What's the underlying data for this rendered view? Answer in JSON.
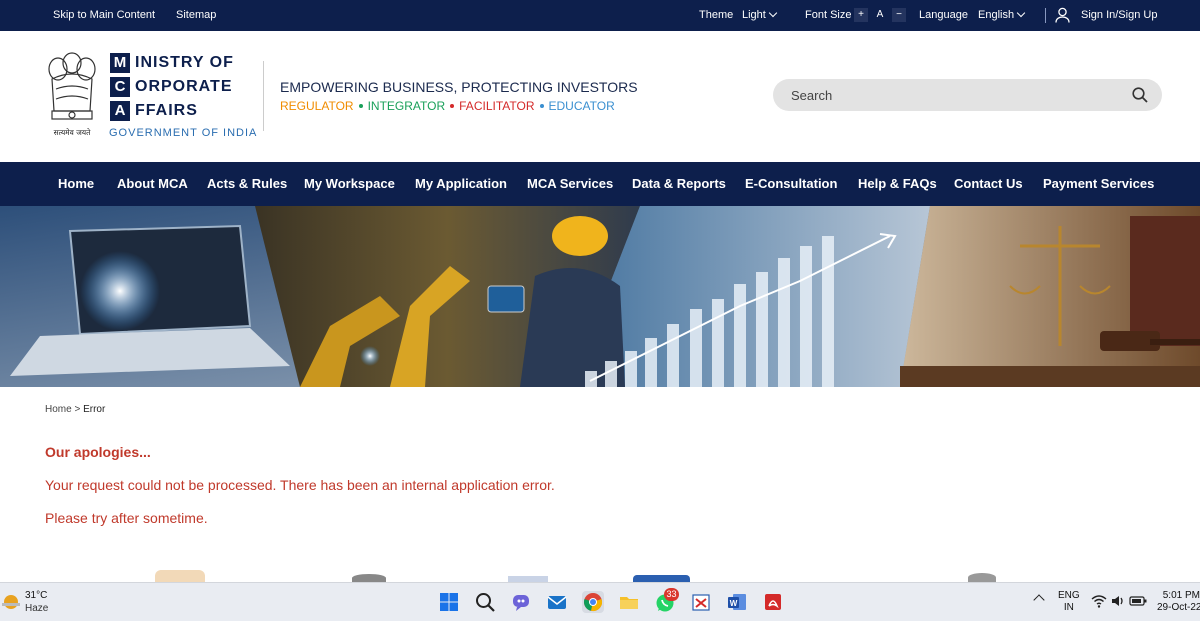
{
  "topbar": {
    "skip": "Skip to Main Content",
    "sitemap": "Sitemap",
    "theme_label": "Theme",
    "theme_value": "Light",
    "font_size_label": "Font Size",
    "font_plus": "+",
    "font_a": "A",
    "font_minus": "−",
    "language_label": "Language",
    "language_value": "English",
    "signin": "Sign In/Sign Up"
  },
  "header": {
    "emblem_motto": "सत्यमेव जयते",
    "logo_letters": [
      "M",
      "C",
      "A"
    ],
    "logo_words": [
      "INISTRY OF",
      "ORPORATE",
      "FFAIRS"
    ],
    "gov": "GOVERNMENT OF INDIA",
    "tagline": "EMPOWERING BUSINESS, PROTECTING INVESTORS",
    "roles": [
      {
        "label": "REGULATOR",
        "color": "#f08c00"
      },
      {
        "label": "INTEGRATOR",
        "color": "#1aa05a"
      },
      {
        "label": "FACILITATOR",
        "color": "#d42a2a"
      },
      {
        "label": "EDUCATOR",
        "color": "#3a8fd0"
      }
    ],
    "search_placeholder": "Search"
  },
  "nav": [
    "Home",
    "About MCA",
    "Acts & Rules",
    "My Workspace",
    "My Application",
    "MCA Services",
    "Data & Reports",
    "E-Consultation",
    "Help & FAQs",
    "Contact Us",
    "Payment Services"
  ],
  "breadcrumb": {
    "home": "Home",
    "sep": ">",
    "current": "Error"
  },
  "error": {
    "title": "Our apologies...",
    "line1": "Your request could not be processed. There has been an internal application error.",
    "line2": "Please try after sometime."
  },
  "taskbar": {
    "temp": "31°C",
    "condition": "Haze",
    "whatsapp_badge": "33",
    "lang_top": "ENG",
    "lang_bottom": "IN",
    "time": "5:01 PM",
    "date": "29-Oct-22"
  },
  "colors": {
    "navy": "#0d1f4c",
    "error_red": "#c0392b"
  }
}
